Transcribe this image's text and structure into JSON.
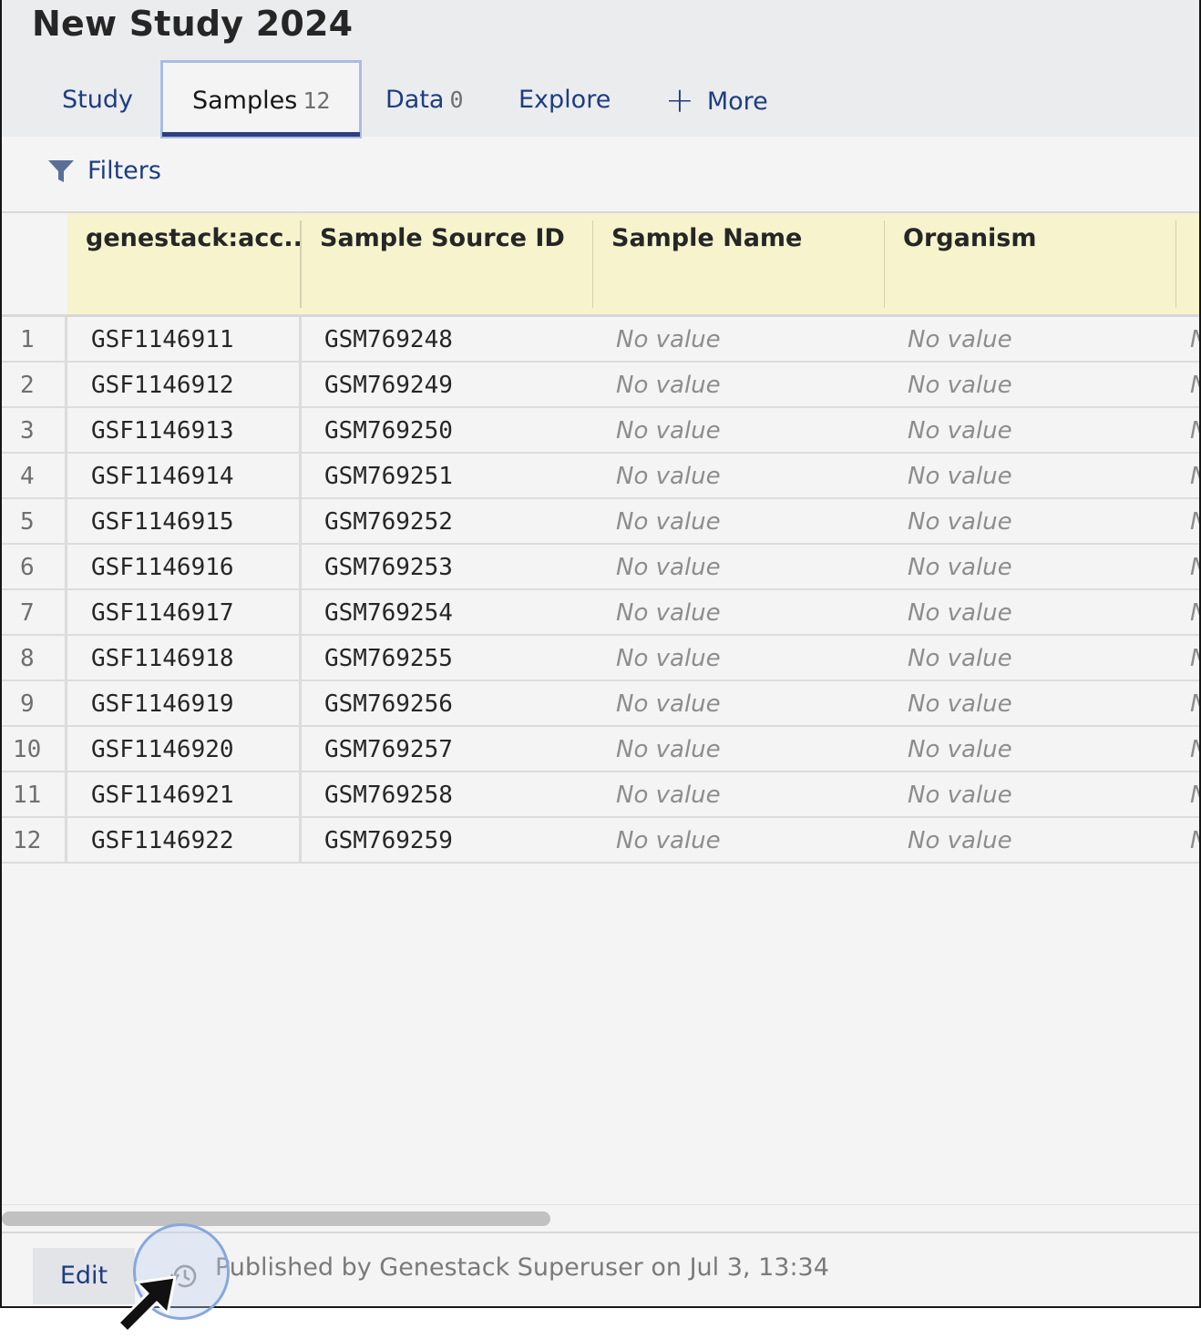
{
  "title": "New Study 2024",
  "tabs": [
    {
      "label": "Study",
      "count": ""
    },
    {
      "label": "Samples",
      "count": "12"
    },
    {
      "label": "Data",
      "count": "0"
    },
    {
      "label": "Explore",
      "count": ""
    },
    {
      "label": "More",
      "count": ""
    }
  ],
  "active_tab": "Samples",
  "filters_label": "Filters",
  "columns": [
    "genestack:acc...",
    "Sample Source ID",
    "Sample Name",
    "Organism"
  ],
  "rows": [
    {
      "n": "1",
      "acc": "GSF1146911",
      "src": "GSM769248",
      "name": "No value",
      "org": "No value"
    },
    {
      "n": "2",
      "acc": "GSF1146912",
      "src": "GSM769249",
      "name": "No value",
      "org": "No value"
    },
    {
      "n": "3",
      "acc": "GSF1146913",
      "src": "GSM769250",
      "name": "No value",
      "org": "No value"
    },
    {
      "n": "4",
      "acc": "GSF1146914",
      "src": "GSM769251",
      "name": "No value",
      "org": "No value"
    },
    {
      "n": "5",
      "acc": "GSF1146915",
      "src": "GSM769252",
      "name": "No value",
      "org": "No value"
    },
    {
      "n": "6",
      "acc": "GSF1146916",
      "src": "GSM769253",
      "name": "No value",
      "org": "No value"
    },
    {
      "n": "7",
      "acc": "GSF1146917",
      "src": "GSM769254",
      "name": "No value",
      "org": "No value"
    },
    {
      "n": "8",
      "acc": "GSF1146918",
      "src": "GSM769255",
      "name": "No value",
      "org": "No value"
    },
    {
      "n": "9",
      "acc": "GSF1146919",
      "src": "GSM769256",
      "name": "No value",
      "org": "No value"
    },
    {
      "n": "10",
      "acc": "GSF1146920",
      "src": "GSM769257",
      "name": "No value",
      "org": "No value"
    },
    {
      "n": "11",
      "acc": "GSF1146921",
      "src": "GSM769258",
      "name": "No value",
      "org": "No value"
    },
    {
      "n": "12",
      "acc": "GSF1146922",
      "src": "GSM769259",
      "name": "No value",
      "org": "No value"
    }
  ],
  "footer": {
    "edit_label": "Edit",
    "published_text": "Published by Genestack Superuser on Jul 3, 13:34"
  },
  "icons": {
    "filters": "filter-icon",
    "more": "plus-icon",
    "history": "history-icon",
    "cursor": "mouse-pointer-icon"
  },
  "colors": {
    "accent": "#1d3c82",
    "header_cells": "#f7f4cd",
    "active_tab_underline": "#2d3f80"
  }
}
